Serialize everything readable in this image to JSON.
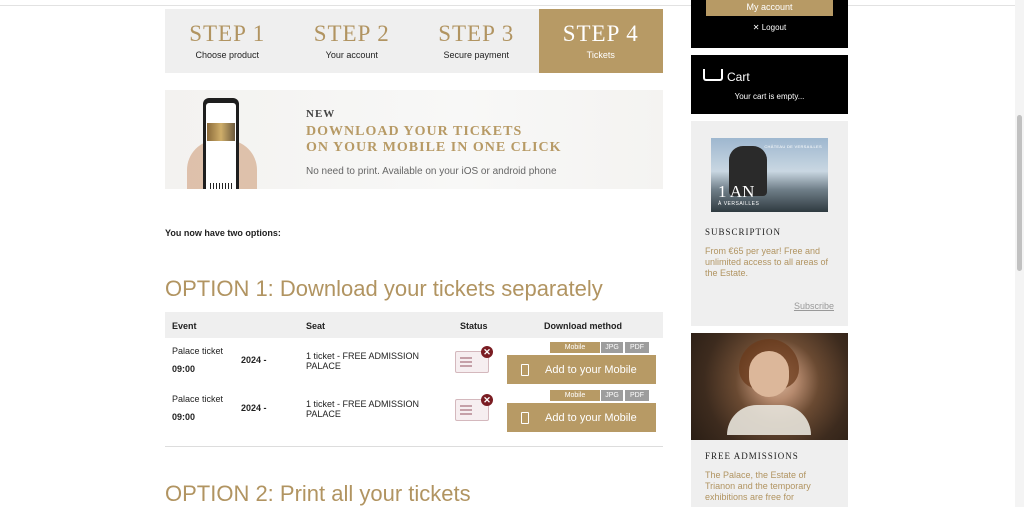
{
  "steps": [
    {
      "num": "STEP 1",
      "label": "Choose product",
      "active": false
    },
    {
      "num": "STEP 2",
      "label": "Your account",
      "active": false
    },
    {
      "num": "STEP 3",
      "label": "Secure payment",
      "active": false
    },
    {
      "num": "STEP 4",
      "label": "Tickets",
      "active": true
    }
  ],
  "banner": {
    "new": "NEW",
    "title_line1": "DOWNLOAD YOUR TICKETS",
    "title_line2": "ON YOUR MOBILE IN ONE CLICK",
    "subtitle": "No need to print. Available on your iOS or android phone"
  },
  "intro": "You now have two options:",
  "option1": "OPTION 1: Download your tickets separately",
  "option2": "OPTION 2: Print all your tickets",
  "table": {
    "headers": {
      "event": "Event",
      "seat": "Seat",
      "status": "Status",
      "download": "Download method"
    },
    "rows": [
      {
        "event": "Palace ticket",
        "time": "09:00",
        "date": "2024 -",
        "seat": "1 ticket - FREE ADMISSION PALACE",
        "formats": [
          "Mobile",
          "JPG",
          "PDF"
        ],
        "button": "Add to your Mobile"
      },
      {
        "event": "Palace ticket",
        "time": "09:00",
        "date": "2024 -",
        "seat": "1 ticket - FREE ADMISSION PALACE",
        "formats": [
          "Mobile",
          "JPG",
          "PDF"
        ],
        "button": "Add to your Mobile"
      }
    ]
  },
  "sidebar": {
    "my_account": "My account",
    "logout": "✕ Logout",
    "cart_title": "Cart",
    "cart_empty": "Your cart is empty...",
    "subscription": {
      "image_big": "1 AN",
      "image_small": "À VERSAILLES",
      "image_logo": "CHÂTEAU DE VERSAILLES",
      "title": "SUBSCRIPTION",
      "desc": "From €65 per year! Free and unlimited access to all areas of the Estate.",
      "link": "Subscribe"
    },
    "free": {
      "title": "FREE ADMISSIONS",
      "desc": "The Palace, the Estate of Trianon and the temporary exhibitions are free for"
    }
  },
  "colors": {
    "accent": "#b79a65",
    "panel": "#efefef",
    "dark": "#000000",
    "error": "#7a1c22"
  }
}
